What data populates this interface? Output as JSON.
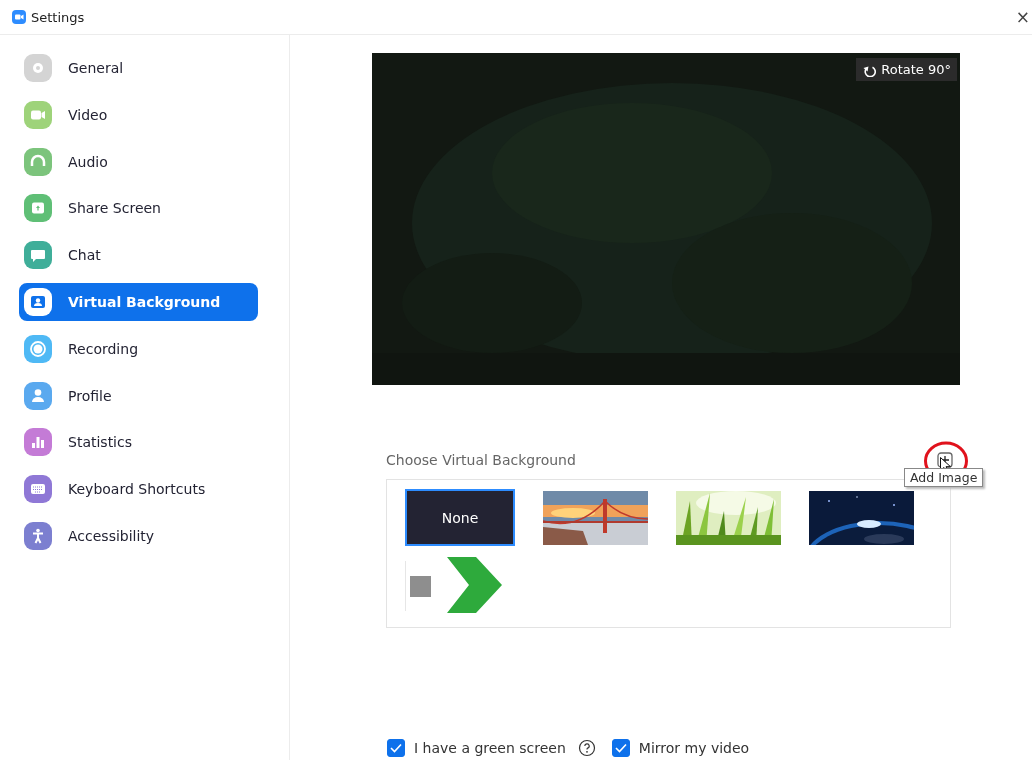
{
  "window": {
    "title": "Settings",
    "close": "×"
  },
  "sidebar": {
    "items": [
      {
        "label": "General",
        "color": "#d4d4d4",
        "selected": false
      },
      {
        "label": "Video",
        "color": "#9ed37a",
        "selected": false
      },
      {
        "label": "Audio",
        "color": "#7cc47c",
        "selected": false
      },
      {
        "label": "Share Screen",
        "color": "#5fbf76",
        "selected": false
      },
      {
        "label": "Chat",
        "color": "#3fae99",
        "selected": false
      },
      {
        "label": "Virtual Background",
        "color": "#0e71eb",
        "selected": true
      },
      {
        "label": "Recording",
        "color": "#4fb9f5",
        "selected": false
      },
      {
        "label": "Profile",
        "color": "#5aa9ef",
        "selected": false
      },
      {
        "label": "Statistics",
        "color": "#c47bd6",
        "selected": false
      },
      {
        "label": "Keyboard Shortcuts",
        "color": "#8f78d6",
        "selected": false
      },
      {
        "label": "Accessibility",
        "color": "#7c7fd0",
        "selected": false
      }
    ]
  },
  "preview": {
    "kind": "picture",
    "rotate_button": "Rotate 90°"
  },
  "backgrounds": {
    "title": "Choose Virtual Background",
    "add_tooltip": "Add Image",
    "annotated": true,
    "items": [
      {
        "kind": "none",
        "label": "None",
        "selected": true
      },
      {
        "kind": "picture",
        "selected": false
      },
      {
        "kind": "picture",
        "selected": false
      },
      {
        "kind": "picture",
        "selected": false
      },
      {
        "kind": "picture",
        "selected": false
      }
    ]
  },
  "options": [
    {
      "label": "I have a green screen",
      "checked": true,
      "help": true
    },
    {
      "label": "Mirror my video",
      "checked": true,
      "help": false
    }
  ]
}
